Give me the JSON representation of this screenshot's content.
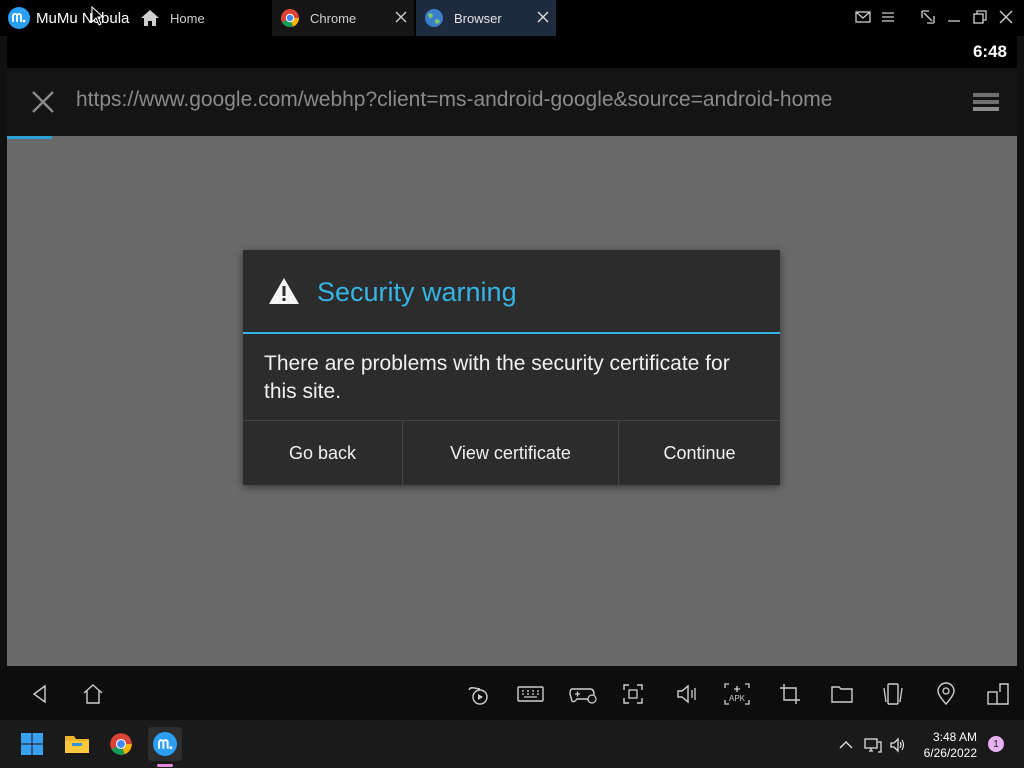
{
  "app": {
    "name": "MuMu Nebula",
    "brand_color": "#2b9ff5"
  },
  "tabs": [
    {
      "label": "Home",
      "icon": "home-icon"
    },
    {
      "label": "Chrome",
      "icon": "chrome-icon"
    },
    {
      "label": "Browser",
      "icon": "globe-icon",
      "active": true
    }
  ],
  "window_controls": [
    "mail-icon",
    "menu-icon",
    "shrink-icon",
    "minimize-icon",
    "restore-icon",
    "close-icon"
  ],
  "android": {
    "clock": "6:48",
    "url": "https://www.google.com/webhp?client=ms-android-google&source=android-home"
  },
  "dialog": {
    "title": "Security warning",
    "message": "There are problems with the security certificate for this site.",
    "buttons": {
      "back": "Go back",
      "view_certificate": "View certificate",
      "continue": "Continue"
    },
    "accent": "#35b5e5"
  },
  "toolbar_icons": [
    "back-nav-icon",
    "home-nav-icon",
    "record-icon",
    "keyboard-icon",
    "gamepad-icon",
    "fullscreen-icon",
    "volume-icon",
    "apk-install-icon",
    "crop-icon",
    "folder-icon",
    "shake-icon",
    "location-icon",
    "multi-window-icon"
  ],
  "taskbar": {
    "time": "3:48 AM",
    "date": "6/26/2022",
    "notification_count": "1"
  }
}
